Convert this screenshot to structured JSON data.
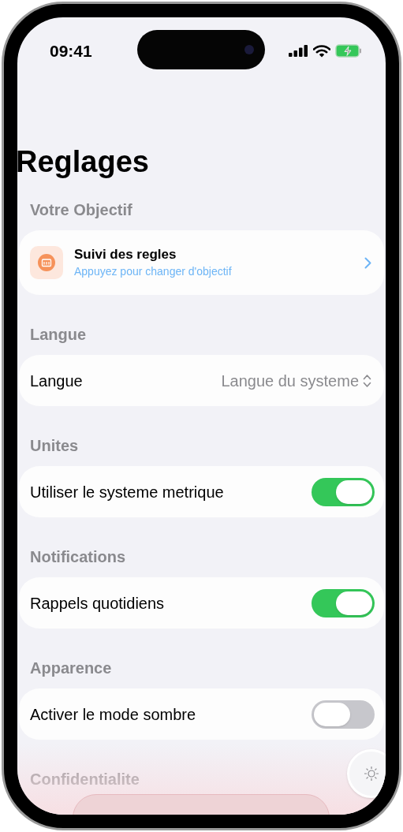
{
  "status_bar": {
    "time": "09:41"
  },
  "title": "Reglages",
  "sections": [
    {
      "header": "Votre Objectif",
      "rows": [
        {
          "kind": "link",
          "label": "Suivi des regles",
          "subtitle": "Appuyez pour changer d'objectif"
        }
      ]
    },
    {
      "header": "Langue",
      "rows": [
        {
          "kind": "picker",
          "label": "Langue",
          "value": "Langue du systeme"
        }
      ]
    },
    {
      "header": "Unites",
      "rows": [
        {
          "kind": "toggle",
          "label": "Utiliser le systeme metrique",
          "on": true
        }
      ]
    },
    {
      "header": "Notifications",
      "rows": [
        {
          "kind": "toggle",
          "label": "Rappels quotidiens",
          "on": true
        }
      ]
    },
    {
      "header": "Apparence",
      "rows": [
        {
          "kind": "toggle",
          "label": "Activer le mode sombre",
          "on": false
        }
      ]
    },
    {
      "header": "Confidentialite"
    }
  ]
}
